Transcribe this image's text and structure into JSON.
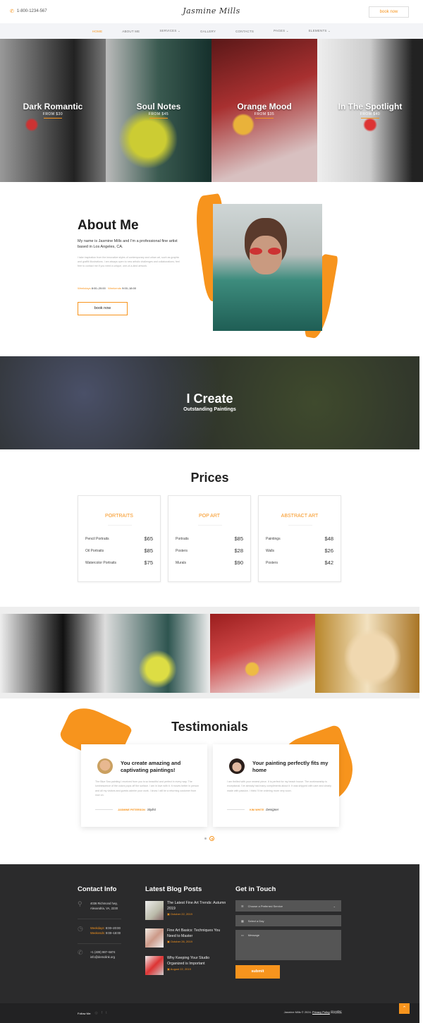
{
  "header": {
    "phone": "1-800-1234-567",
    "logo": "Jasmine Mills",
    "book_label": "book now"
  },
  "nav": {
    "items": [
      {
        "label": "HOME",
        "active": true
      },
      {
        "label": "ABOUT ME"
      },
      {
        "label": "SERVICES ⌄"
      },
      {
        "label": "GALLERY"
      },
      {
        "label": "CONTACTS"
      },
      {
        "label": "PAGES ⌄"
      },
      {
        "label": "ELEMENTS ⌄"
      }
    ]
  },
  "hero": {
    "panels": [
      {
        "title": "Dark Romantic",
        "price": "FROM $30"
      },
      {
        "title": "Soul Notes",
        "price": "FROM $45"
      },
      {
        "title": "Orange Mood",
        "price": "FROM $35"
      },
      {
        "title": "In The Spotlight",
        "price": "FROM $40"
      }
    ]
  },
  "about": {
    "title": "About Me",
    "lead": "My name is Jasmine Mills and I'm a professional fine artist based in Los Angeles, CA.",
    "body": "I take inspiration from the innovative styles of contemporary and urban art, such as graphic and graffiti illustrations. I am always open to new artistic challenges and collaborations; feel free to contact me if you need a unique, one-of-a-kind artwork.",
    "weekdays_label": "Weekdays",
    "weekdays_hours": "8:00–20:00",
    "weekends_label": "Weekends",
    "weekends_hours": "9:00–18:00",
    "book_label": "book now"
  },
  "create": {
    "title": "I Create",
    "subtitle": "Outstanding Paintings"
  },
  "prices": {
    "title": "Prices",
    "cards": [
      {
        "title": "PORTRAITS",
        "items": [
          {
            "name": "Pencil Portraits",
            "price": "$65"
          },
          {
            "name": "Oil Portraits",
            "price": "$85"
          },
          {
            "name": "Watercolor Portraits",
            "price": "$75"
          }
        ]
      },
      {
        "title": "POP ART",
        "items": [
          {
            "name": "Portraits",
            "price": "$85"
          },
          {
            "name": "Posters",
            "price": "$28"
          },
          {
            "name": "Murals",
            "price": "$90"
          }
        ]
      },
      {
        "title": "ABSTRACT ART",
        "items": [
          {
            "name": "Paintings",
            "price": "$48"
          },
          {
            "name": "Walls",
            "price": "$26"
          },
          {
            "name": "Posters",
            "price": "$42"
          }
        ]
      }
    ]
  },
  "testimonials": {
    "title": "Testimonials",
    "items": [
      {
        "title": "You create amazing and captivating paintings!",
        "body": "The Blue Sea painting I received from you is so beautiful and perfect in every way. The luminescence of the colors pops off the surface. I am in love with it. It moves better in person and all my visitors and guests admire your work. I know I will be a returning customer from now on.",
        "name": "JASMINE PETERSON",
        "role": "Stylist"
      },
      {
        "title": "Your painting perfectly fits my home",
        "body": "I am thrilled with your newest piece. It is perfect for my beach house. The workmanship is exceptional. I've already had many compliments about it. It was shipped with care and clearly made with passion. I think I'll be ordering more very soon.",
        "name": "KIM WHITE",
        "role": "Designer"
      }
    ]
  },
  "footer": {
    "contact": {
      "title": "Contact Info",
      "address": "4036 Richmond hwy, Alexandria, VA, 2230",
      "weekdays_label": "Weekdays:",
      "weekdays_hours": "8:00–20:00",
      "weekends_label": "Weekends:",
      "weekends_hours": "9:00–18:00",
      "phone": "+1 (409) 987–5874",
      "email": "info@demolink.org"
    },
    "blog": {
      "title": "Latest Blog Posts",
      "posts": [
        {
          "title": "The Latest Fine Art Trends: Autumn 2019",
          "date": "October 22, 2019"
        },
        {
          "title": "Fine Art Basics: Techniques You Need to Master",
          "date": "October 26, 2019"
        },
        {
          "title": "Why Keeping Your Studio Organized is Important",
          "date": "August 22, 2019"
        }
      ]
    },
    "form": {
      "title": "Get in Touch",
      "service_placeholder": "Choose a Preferred Service",
      "day_placeholder": "Select a Day",
      "message_placeholder": "Message",
      "submit_label": "submit"
    },
    "follow_label": "Follow Me:",
    "copyright": "Jasmine Mills © 2024.",
    "privacy": "Privacy Policy",
    "extra": "网站模板"
  },
  "colors": {
    "accent": "#f7941d",
    "footer_bg": "#2b2b2c",
    "nav_bg": "#f3f4f7"
  }
}
